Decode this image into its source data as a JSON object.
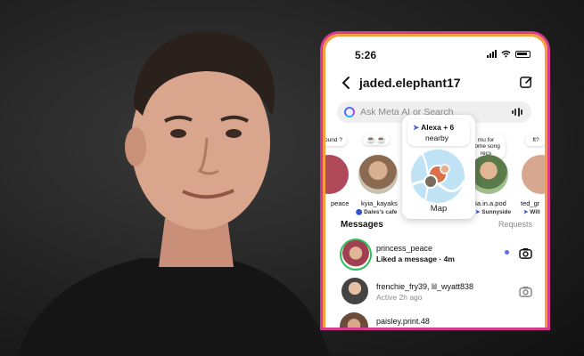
{
  "status_bar": {
    "time": "5:26"
  },
  "header": {
    "title": "jaded.elephant17"
  },
  "search": {
    "placeholder": "Ask Meta AI or Search"
  },
  "notes": [
    {
      "note": "ound ?",
      "username": "peace",
      "location": ""
    },
    {
      "note": "☕☕",
      "username": "kyia_kayaks",
      "location": "Dales's cafe"
    },
    {
      "note": "mu for some song recs",
      "username": "pia.in.a.pod",
      "location": "Sunnyside"
    },
    {
      "note": "ft?",
      "username": "ted_gr",
      "location": "Will"
    }
  ],
  "map": {
    "title": "Alexa + 6",
    "subtitle": "nearby",
    "label": "Map"
  },
  "messages_section": {
    "title": "Messages",
    "requests": "Requests"
  },
  "messages": [
    {
      "name": "princess_peace",
      "subtitle": "Liked a message · 4m",
      "unread": true
    },
    {
      "name": "frenchie_fry39, lil_wyatt838",
      "subtitle": "Active 2h ago",
      "unread": false
    },
    {
      "name": "paisley.print.48",
      "subtitle": "",
      "unread": false
    }
  ],
  "colors": {
    "accent_ring": "#d63a8f",
    "unread_dot": "#5b6cf0",
    "story_ring": "#2fbf5a"
  }
}
